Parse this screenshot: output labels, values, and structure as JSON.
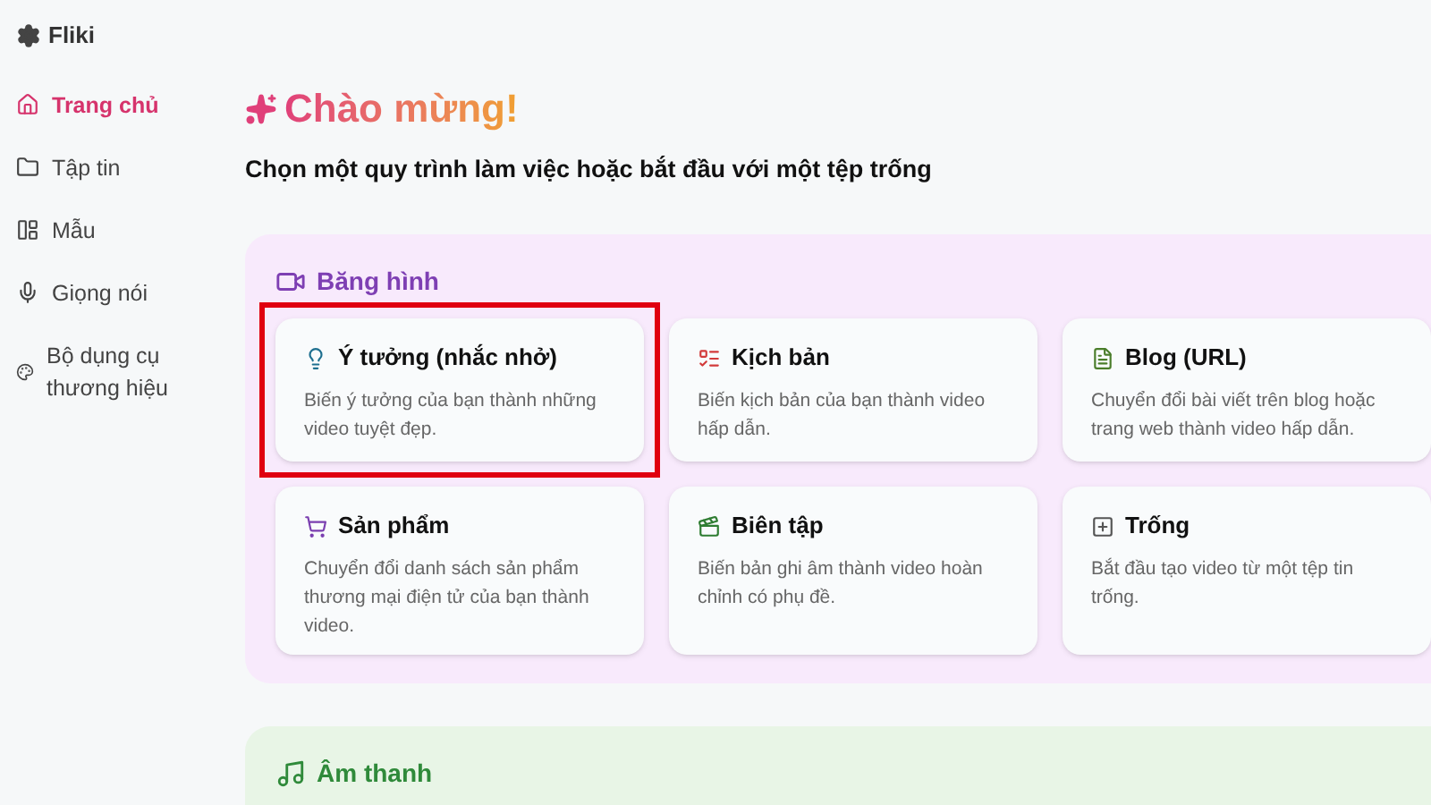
{
  "app": {
    "name": "Fliki"
  },
  "sidebar": {
    "items": [
      {
        "label": "Trang chủ",
        "selected": true
      },
      {
        "label": "Tập tin",
        "selected": false
      },
      {
        "label": "Mẫu",
        "selected": false
      },
      {
        "label": "Giọng nói",
        "selected": false
      },
      {
        "label": "Bộ dụng cụ thương hiệu",
        "selected": false
      }
    ]
  },
  "heading": "Chào mừng!",
  "subheading": "Chọn một quy trình làm việc hoặc bắt đầu với một tệp trống",
  "sections": [
    {
      "title": "Băng hình",
      "kind": "video",
      "cards": [
        {
          "title": "Ý tưởng (nhắc nhở)",
          "description": "Biến ý tưởng của bạn thành những video tuyệt đẹp.",
          "highlighted": true
        },
        {
          "title": "Kịch bản",
          "description": "Biến kịch bản của bạn thành video hấp dẫn.",
          "highlighted": false
        },
        {
          "title": "Blog (URL)",
          "description": "Chuyển đổi bài viết trên blog hoặc trang web thành video hấp dẫn.",
          "highlighted": false
        },
        {
          "title": "Sản phẩm",
          "description": "Chuyển đổi danh sách sản phẩm thương mại điện tử của bạn thành video.",
          "highlighted": false
        },
        {
          "title": "Biên tập",
          "description": "Biến bản ghi âm thành video hoàn chỉnh có phụ đề.",
          "highlighted": false
        },
        {
          "title": "Trống",
          "description": "Bắt đầu tạo video từ một tệp tin trống.",
          "highlighted": false
        }
      ]
    },
    {
      "title": "Âm thanh",
      "kind": "audio"
    }
  ]
}
